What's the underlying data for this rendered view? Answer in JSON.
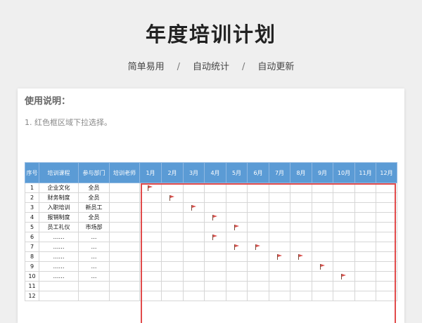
{
  "header": {
    "title": "年度培训计划",
    "features": [
      "简单易用",
      "自动统计",
      "自动更新"
    ],
    "separator": "/"
  },
  "instructions": {
    "title": "使用说明：",
    "items": [
      "1. 红色框区域下拉选择。"
    ]
  },
  "table": {
    "columns": [
      "序号",
      "培训课程",
      "参与部门",
      "培训老师",
      "1月",
      "2月",
      "3月",
      "4月",
      "5月",
      "6月",
      "7月",
      "8月",
      "9月",
      "10月",
      "11月",
      "12月"
    ],
    "rows": [
      {
        "no": "1",
        "course": "企业文化",
        "dept": "全员",
        "teacher": "",
        "months": [
          1
        ]
      },
      {
        "no": "2",
        "course": "财务制度",
        "dept": "全员",
        "teacher": "",
        "months": [
          2
        ]
      },
      {
        "no": "3",
        "course": "入职培训",
        "dept": "新员工",
        "teacher": "",
        "months": [
          3
        ]
      },
      {
        "no": "4",
        "course": "报销制度",
        "dept": "全员",
        "teacher": "",
        "months": [
          4
        ]
      },
      {
        "no": "5",
        "course": "员工礼仪",
        "dept": "市场部",
        "teacher": "",
        "months": [
          5
        ]
      },
      {
        "no": "6",
        "course": "……",
        "dept": "…",
        "teacher": "",
        "months": [
          4
        ]
      },
      {
        "no": "7",
        "course": "……",
        "dept": "…",
        "teacher": "",
        "months": [
          5,
          6
        ]
      },
      {
        "no": "8",
        "course": "……",
        "dept": "…",
        "teacher": "",
        "months": [
          7,
          8
        ]
      },
      {
        "no": "9",
        "course": "……",
        "dept": "…",
        "teacher": "",
        "months": [
          9
        ]
      },
      {
        "no": "10",
        "course": "……",
        "dept": "…",
        "teacher": "",
        "months": [
          10
        ]
      },
      {
        "no": "11",
        "course": "",
        "dept": "",
        "teacher": "",
        "months": []
      },
      {
        "no": "12",
        "course": "",
        "dept": "",
        "teacher": "",
        "months": []
      }
    ]
  },
  "colors": {
    "header_bg": "#5b9bd5",
    "frame": "#e14b4b",
    "flag": "#d9534f"
  },
  "icons": {
    "month_marker": "flag-icon"
  }
}
